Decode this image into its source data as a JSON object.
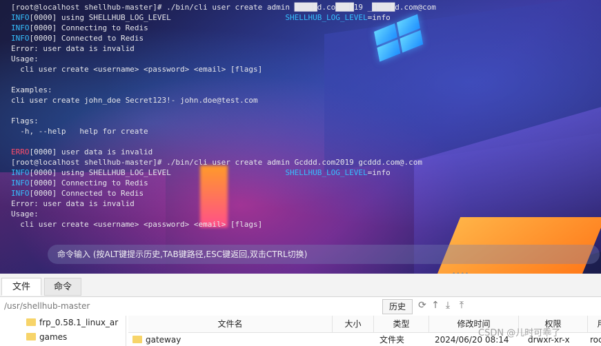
{
  "terminal": {
    "lines": [
      [
        {
          "t": "[root@localhost shellhub-master]# ./bin/cli user create admin █████d.co████19 _█████d.com@com"
        }
      ],
      [
        {
          "t": "INFO",
          "c": "info"
        },
        {
          "t": "[0000] using SHELLHUB_LOG_LEVEL                         "
        },
        {
          "t": "SHELLHUB_LOG_LEVEL",
          "c": "info"
        },
        {
          "t": "=info"
        }
      ],
      [
        {
          "t": "INFO",
          "c": "info"
        },
        {
          "t": "[0000] Connecting to Redis"
        }
      ],
      [
        {
          "t": "INFO",
          "c": "info"
        },
        {
          "t": "[0000] Connected to Redis"
        }
      ],
      [
        {
          "t": "Error: user data is invalid"
        }
      ],
      [
        {
          "t": "Usage:"
        }
      ],
      [
        {
          "t": "  cli user create <username> <password> <email> [flags]"
        }
      ],
      [
        {
          "t": ""
        }
      ],
      [
        {
          "t": "Examples:"
        }
      ],
      [
        {
          "t": "cli user create john_doe Secret123!- john.doe@test.com"
        }
      ],
      [
        {
          "t": ""
        }
      ],
      [
        {
          "t": "Flags:"
        }
      ],
      [
        {
          "t": "  -h, --help   help for create"
        }
      ],
      [
        {
          "t": ""
        }
      ],
      [
        {
          "t": "ERRO",
          "c": "erro"
        },
        {
          "t": "[0000] user data is invalid"
        }
      ],
      [
        {
          "t": "[root@localhost shellhub-master]# ./bin/cli user create admin Gcddd.com2019 gcddd.com@.com"
        }
      ],
      [
        {
          "t": "INFO",
          "c": "info"
        },
        {
          "t": "[0000] using SHELLHUB_LOG_LEVEL                         "
        },
        {
          "t": "SHELLHUB_LOG_LEVEL",
          "c": "info"
        },
        {
          "t": "=info"
        }
      ],
      [
        {
          "t": "INFO",
          "c": "info"
        },
        {
          "t": "[0000] Connecting to Redis"
        }
      ],
      [
        {
          "t": "INFO",
          "c": "info"
        },
        {
          "t": "[0000] Connected to Redis"
        }
      ],
      [
        {
          "t": "Error: user data is invalid"
        }
      ],
      [
        {
          "t": "Usage:"
        }
      ],
      [
        {
          "t": "  cli user create <username> <password> <email> [flags]"
        }
      ]
    ],
    "command_hint": "命令输入 (按ALT键提示历史,TAB键路径,ESC键返回,双击CTRL切换)",
    "scroll_indicator": "••••"
  },
  "tabs": [
    {
      "label": "文件",
      "active": true
    },
    {
      "label": "命令",
      "active": false
    }
  ],
  "pathbar": {
    "path": "/usr/shellhub-master",
    "history_label": "历史",
    "icons": [
      "refresh-icon",
      "up-arrow-icon",
      "download-icon",
      "upload-icon"
    ]
  },
  "tree": {
    "items": [
      {
        "label": "frp_0.58.1_linux_ar"
      },
      {
        "label": "games"
      }
    ]
  },
  "file_table": {
    "columns": [
      "文件名",
      "大小",
      "类型",
      "修改时间",
      "权限",
      "用"
    ],
    "rows": [
      {
        "name": "gateway",
        "size": "",
        "type": "文件夹",
        "modified": "2024/06/20 08:14",
        "permissions": "drwxr-xr-x",
        "owner": "roc"
      }
    ]
  },
  "watermark": "CSDN @儿时可乖了",
  "colors": {
    "info": "#36c0ff",
    "erro": "#ff4d6a",
    "folder": "#f7d469"
  }
}
